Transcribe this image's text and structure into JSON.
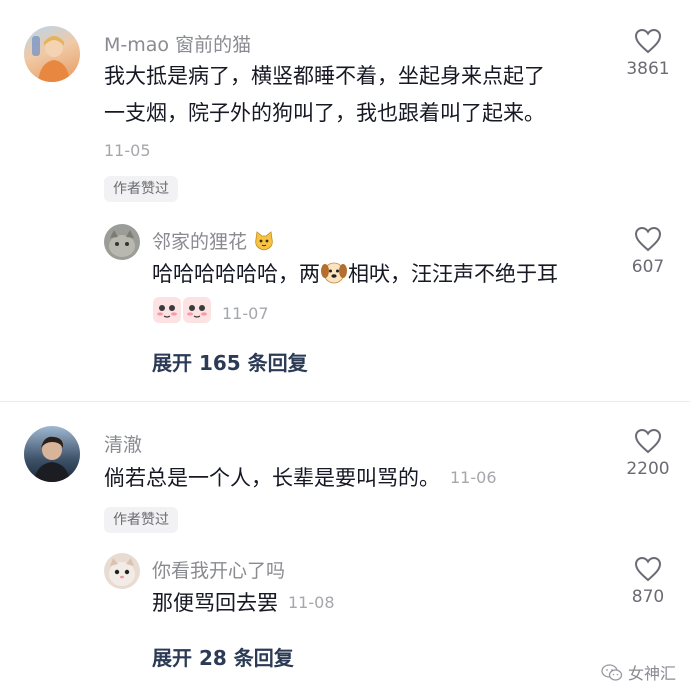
{
  "comments": [
    {
      "user": "M-mao 窗前的猫",
      "text_line1": "我大抵是病了，横竖都睡不着，坐起身来点起了",
      "text_line2": "一支烟，院子外的狗叫了，我也跟着叫了起来。",
      "date": "11-05",
      "badge": "作者赞过",
      "likes": "3861",
      "reply": {
        "user": "邻家的狸花",
        "text_pre": "哈哈哈哈哈哈，两",
        "text_post": "相吠，汪汪声不绝于耳",
        "date": "11-07",
        "likes": "607",
        "expand": "展开 165 条回复"
      }
    },
    {
      "user": "清澈",
      "text": "倘若总是一个人，长辈是要叫骂的。",
      "date": "11-06",
      "badge": "作者赞过",
      "likes": "2200",
      "reply": {
        "user": "你看我开心了吗",
        "text": "那便骂回去罢",
        "date": "11-08",
        "likes": "870",
        "expand": "展开 28 条回复"
      }
    }
  ],
  "watermark": "女神汇",
  "colors": {
    "username": "#8a8b91",
    "text": "#161823",
    "date": "#a6a7ab",
    "expand": "#2b3a55",
    "badge_bg": "#f2f2f4"
  }
}
